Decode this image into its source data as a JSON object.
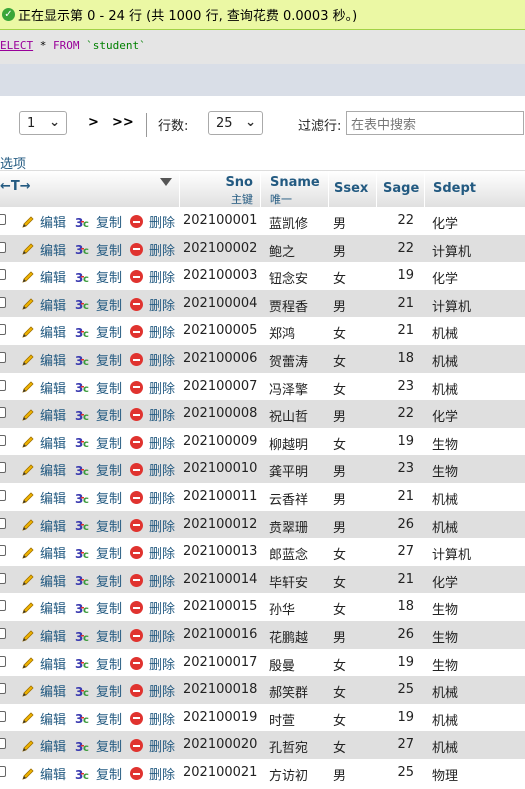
{
  "message": {
    "text": "正在显示第 0 - 24 行 (共 1000 行, 查询花费 0.0003 秒。)"
  },
  "sql": {
    "select_kw": "ELECT",
    "star": " * ",
    "from_kw": "FROM",
    "table": " `student`"
  },
  "nav": {
    "page_value": "1",
    "next_label": ">",
    "last_label": ">>",
    "rows_label": "行数:",
    "rows_value": "25",
    "filter_label": "过滤行:",
    "filter_placeholder": "在表中搜索"
  },
  "options_label": "选项",
  "header": {
    "arrows": "←T→",
    "columns": [
      {
        "name": "Sno",
        "sub": "主键"
      },
      {
        "name": "Sname",
        "sub": "唯一"
      },
      {
        "name": "Ssex",
        "sub": ""
      },
      {
        "name": "Sage",
        "sub": ""
      },
      {
        "name": "Sdept",
        "sub": ""
      }
    ]
  },
  "actions": {
    "edit": "编辑",
    "copy": "复制",
    "delete": "删除"
  },
  "rows": [
    {
      "sno": "202100001",
      "sname": "蓝凯修",
      "ssex": "男",
      "sage": "22",
      "sdept": "化学"
    },
    {
      "sno": "202100002",
      "sname": "鲍之",
      "ssex": "男",
      "sage": "22",
      "sdept": "计算机"
    },
    {
      "sno": "202100003",
      "sname": "钮念安",
      "ssex": "女",
      "sage": "19",
      "sdept": "化学"
    },
    {
      "sno": "202100004",
      "sname": "贾程香",
      "ssex": "男",
      "sage": "21",
      "sdept": "计算机"
    },
    {
      "sno": "202100005",
      "sname": "郑鸿",
      "ssex": "女",
      "sage": "21",
      "sdept": "机械"
    },
    {
      "sno": "202100006",
      "sname": "贺蕾涛",
      "ssex": "女",
      "sage": "18",
      "sdept": "机械"
    },
    {
      "sno": "202100007",
      "sname": "冯泽擎",
      "ssex": "女",
      "sage": "23",
      "sdept": "机械"
    },
    {
      "sno": "202100008",
      "sname": "祝山哲",
      "ssex": "男",
      "sage": "22",
      "sdept": "化学"
    },
    {
      "sno": "202100009",
      "sname": "柳越明",
      "ssex": "女",
      "sage": "19",
      "sdept": "生物"
    },
    {
      "sno": "202100010",
      "sname": "龚平明",
      "ssex": "男",
      "sage": "23",
      "sdept": "生物"
    },
    {
      "sno": "202100011",
      "sname": "云香祥",
      "ssex": "男",
      "sage": "21",
      "sdept": "机械"
    },
    {
      "sno": "202100012",
      "sname": "贲翠珊",
      "ssex": "男",
      "sage": "26",
      "sdept": "机械"
    },
    {
      "sno": "202100013",
      "sname": "郎蓝念",
      "ssex": "女",
      "sage": "27",
      "sdept": "计算机"
    },
    {
      "sno": "202100014",
      "sname": "毕轩安",
      "ssex": "女",
      "sage": "21",
      "sdept": "化学"
    },
    {
      "sno": "202100015",
      "sname": "孙华",
      "ssex": "女",
      "sage": "18",
      "sdept": "生物"
    },
    {
      "sno": "202100016",
      "sname": "花鹏越",
      "ssex": "男",
      "sage": "26",
      "sdept": "生物"
    },
    {
      "sno": "202100017",
      "sname": "殷曼",
      "ssex": "女",
      "sage": "19",
      "sdept": "生物"
    },
    {
      "sno": "202100018",
      "sname": "郝笑群",
      "ssex": "女",
      "sage": "25",
      "sdept": "机械"
    },
    {
      "sno": "202100019",
      "sname": "时萱",
      "ssex": "女",
      "sage": "19",
      "sdept": "机械"
    },
    {
      "sno": "202100020",
      "sname": "孔哲宛",
      "ssex": "女",
      "sage": "27",
      "sdept": "机械"
    },
    {
      "sno": "202100021",
      "sname": "方访初",
      "ssex": "男",
      "sage": "25",
      "sdept": "物理"
    }
  ]
}
